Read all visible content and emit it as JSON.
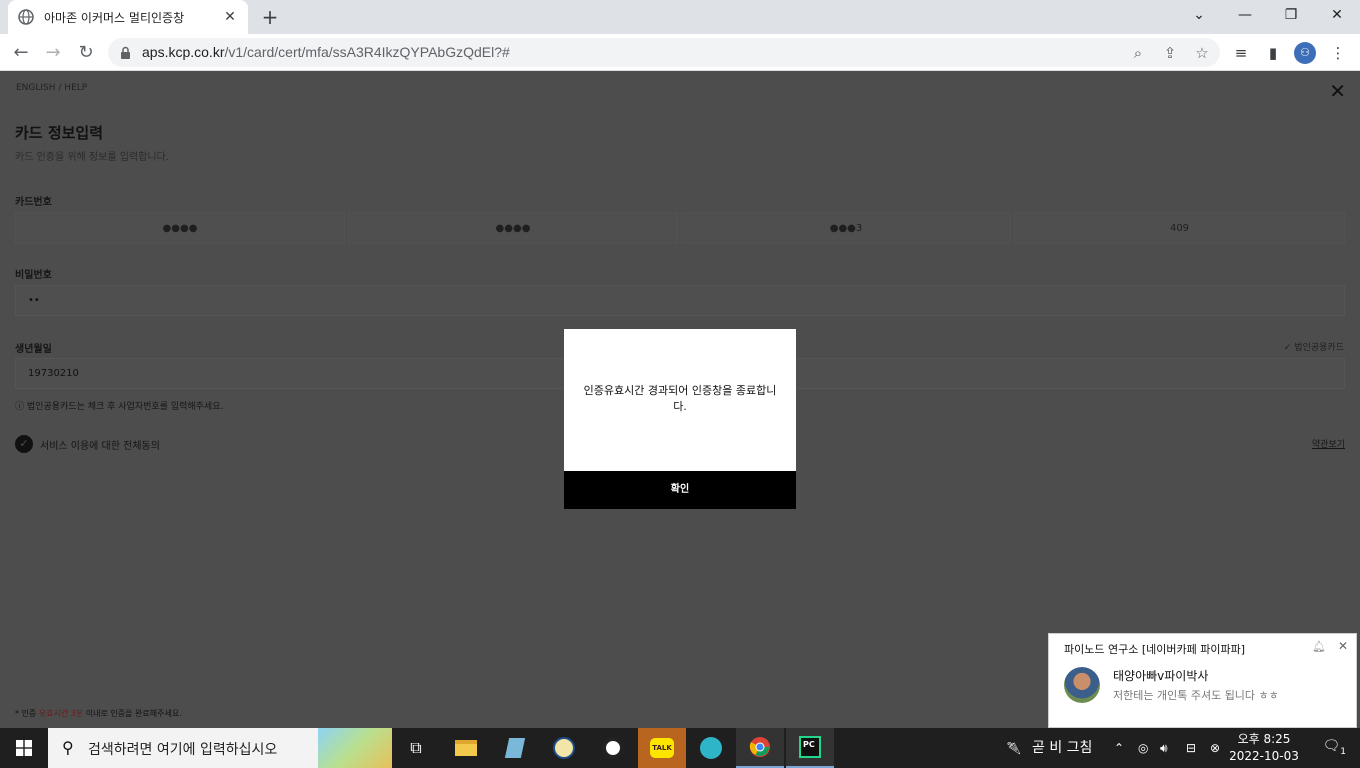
{
  "browser": {
    "tab_title": "아마존 이커머스 멀티인증창",
    "url_host": "aps.kcp.co.kr",
    "url_path": "/v1/card/cert/mfa/ssA3R4IkzQYPAbGzQdEl?#"
  },
  "page": {
    "lang_links": "ENGLISH  /  HELP",
    "title": "카드 정보입력",
    "subtitle": "카드 인증을 위해 정보를 입력합니다.",
    "card_number_label": "카드번호",
    "card_fields": [
      "●●●●",
      "●●●●",
      "●●●3",
      "409"
    ],
    "password_label": "비밀번호",
    "password_value": "••",
    "birth_label": "생년월일",
    "birth_value": "19730210",
    "corp_card_label": "✓ 법인공용카드",
    "corp_notice": "법인공용카드는 체크 후 사업자번호를 입력해주세요.",
    "agree_label": "서비스 이용에 대한 전체동의",
    "terms_link": "약관보기",
    "footnote_prefix": "* 인증 ",
    "footnote_highlight": "유효시간 3분",
    "footnote_suffix": " 이내로 인증을 완료해주세요."
  },
  "modal": {
    "message": "인증유효시간 경과되어 인증창을 종료합니다.",
    "ok_label": "확인"
  },
  "toast": {
    "title": "파이노드 연구소 [네이버카페 파이파파]",
    "sender": "태양아빠v파이박사",
    "message": "저한테는 개인톡 주셔도 됩니다 ㅎㅎ"
  },
  "taskbar": {
    "search_placeholder": "검색하려면 여기에 입력하십시오",
    "weather": "곧 비 그침",
    "time": "오후 8:25",
    "date": "2022-10-03",
    "notification_count": "1"
  }
}
